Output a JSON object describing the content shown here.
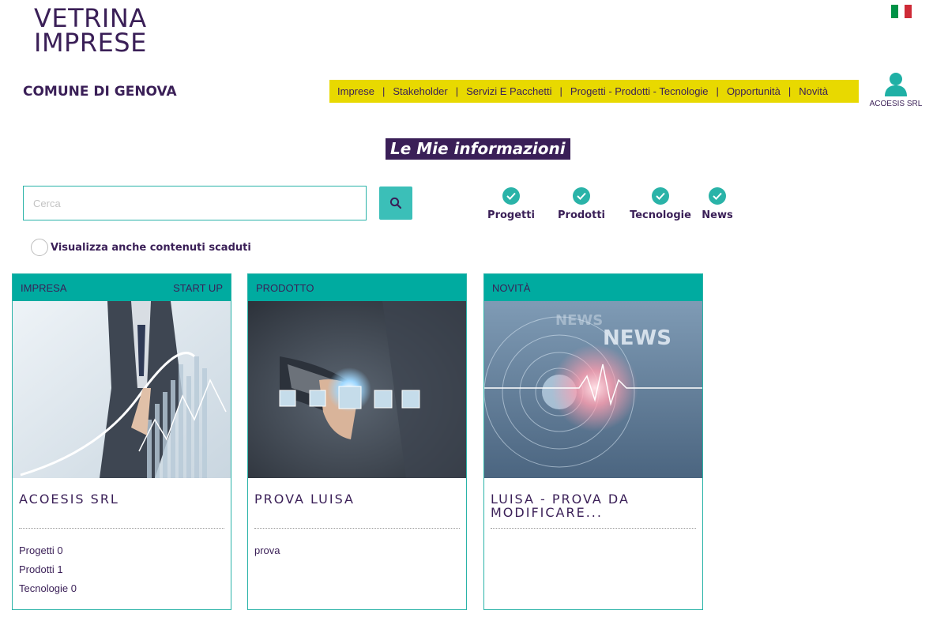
{
  "logo": {
    "line1": "VETRINA",
    "line2": "IMPRESE"
  },
  "flag": {
    "name": "italy-flag",
    "colors": [
      "#009246",
      "#ffffff",
      "#ce2b37"
    ]
  },
  "city": "COMUNE DI GENOVA",
  "nav": {
    "items": [
      "Imprese",
      "Stakeholder",
      "Servizi E Pacchetti",
      "Progetti - Prodotti - Tecnologie",
      "Opportunità",
      "Novità"
    ],
    "separator": "|"
  },
  "user": {
    "icon": "user-icon",
    "name": "ACOESIS SRL"
  },
  "page_title": "Le Mie informazioni",
  "search": {
    "placeholder": "Cerca",
    "value": "",
    "button_icon": "search-icon"
  },
  "filters": [
    {
      "label": "Progetti",
      "checked": true
    },
    {
      "label": "Prodotti",
      "checked": true
    },
    {
      "label": "Tecnologie",
      "checked": true
    },
    {
      "label": "News",
      "checked": true
    }
  ],
  "expired_toggle": {
    "label": "Visualizza anche contenuti scaduti",
    "checked": false
  },
  "colors": {
    "primary": "#3a1f57",
    "accent": "#00aba0",
    "nav_bg": "#e8d900",
    "search_btn": "#3bbfb8"
  },
  "cards": [
    {
      "type": "IMPRESA",
      "badge": "START UP",
      "image": "business-growth-chart-image",
      "title": "ACOESIS SRL",
      "lines": [
        "Progetti 0",
        "Prodotti 1",
        "Tecnologie 0"
      ]
    },
    {
      "type": "PRODOTTO",
      "badge": "",
      "image": "hand-touching-cubes-image",
      "title": "PROVA LUISA",
      "lines": [
        "prova"
      ]
    },
    {
      "type": "NOVITÀ",
      "badge": "",
      "image": "news-globe-image",
      "title": "LUISA - PROVA DA MODIFICARE...",
      "lines": []
    }
  ]
}
